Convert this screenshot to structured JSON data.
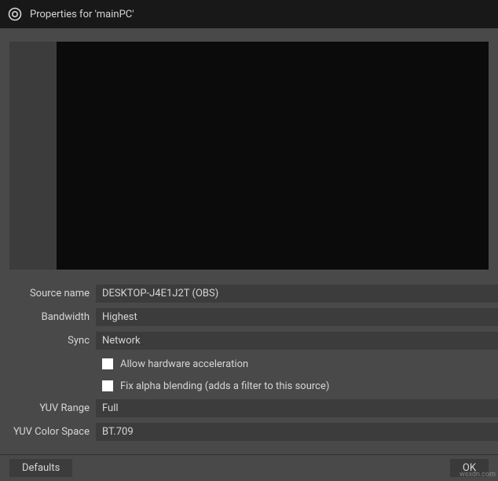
{
  "titlebar": {
    "title": "Properties for 'mainPC'"
  },
  "form": {
    "source_name": {
      "label": "Source name",
      "value": "DESKTOP-J4E1J2T (OBS)"
    },
    "bandwidth": {
      "label": "Bandwidth",
      "value": "Highest"
    },
    "sync": {
      "label": "Sync",
      "value": "Network"
    },
    "allow_hw_accel": {
      "label": "Allow hardware acceleration",
      "checked": false
    },
    "fix_alpha": {
      "label": "Fix alpha blending (adds a filter to this source)",
      "checked": false
    },
    "yuv_range": {
      "label": "YUV Range",
      "value": "Full"
    },
    "yuv_color_space": {
      "label": "YUV Color Space",
      "value": "BT.709"
    }
  },
  "footer": {
    "defaults": "Defaults",
    "ok": "OK"
  }
}
